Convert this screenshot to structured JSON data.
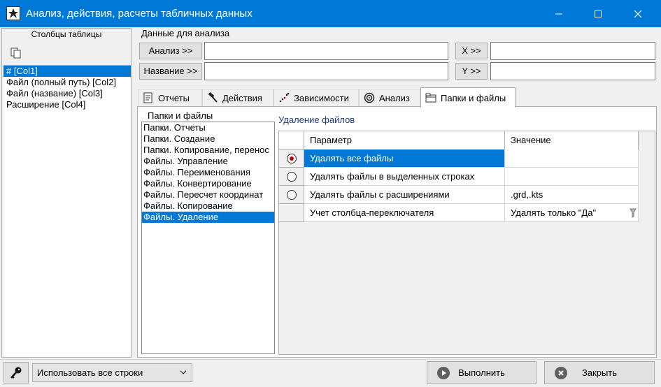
{
  "window": {
    "title": "Анализ, действия, расчеты табличных данных",
    "minimize_glyph": "—",
    "maximize_glyph": "☐",
    "close_glyph": "✕"
  },
  "columns_panel": {
    "title": "Столбцы таблицы",
    "items": [
      "# [Col1]",
      "Файл (полный путь) [Col2]",
      "Файл (название) [Col3]",
      "Расширение [Col4]"
    ],
    "selected_index": 0
  },
  "data_group": {
    "title": "Данные для анализа",
    "analysis_button": "Анализ >>",
    "name_button": "Название >>",
    "x_button": "X >>",
    "y_button": "Y >>",
    "analysis_value": "",
    "name_value": "",
    "x_value": "",
    "y_value": ""
  },
  "tabs": [
    {
      "label": "Отчеты",
      "icon": "report-icon"
    },
    {
      "label": "Действия",
      "icon": "hammer-icon"
    },
    {
      "label": "Зависимости",
      "icon": "scatter-icon"
    },
    {
      "label": "Анализ",
      "icon": "target-icon"
    },
    {
      "label": "Папки и файлы",
      "icon": "folder-icon"
    }
  ],
  "active_tab": 4,
  "folders_group": {
    "title": "Папки и файлы",
    "items": [
      "Папки. Отчеты",
      "Папки. Создание",
      "Папки. Копирование, перенос",
      "Файлы. Управление",
      "Файлы. Переименования",
      "Файлы. Конвертирование",
      "Файлы. Пересчет координат",
      "Файлы. Копирование",
      "Файлы. Удаление"
    ],
    "selected_index": 8
  },
  "detail": {
    "title": "Удаление файлов",
    "columns": [
      "Параметр",
      "Значение"
    ],
    "rows": [
      {
        "marker": "radio-checked",
        "param": "Удалять все файлы",
        "value": "",
        "selected": true
      },
      {
        "marker": "radio",
        "param": "Удалять файлы в выделенных строках",
        "value": "",
        "selected": false
      },
      {
        "marker": "radio",
        "param": "Удалять файлы с расширениями",
        "value": ".grd,.kts",
        "selected": false
      },
      {
        "marker": "none",
        "param": "Учет столбца-переключателя",
        "value": "Удалять только \"Да\"",
        "selected": false
      }
    ]
  },
  "bottom": {
    "rows_select": "Использовать все строки",
    "run_button": "Выполнить",
    "close_button": "Закрыть"
  },
  "colors": {
    "titlebar": "#0078d7",
    "selection": "#0078d7",
    "radio_dot": "#c00000",
    "detail_title": "#1f3a8a"
  }
}
